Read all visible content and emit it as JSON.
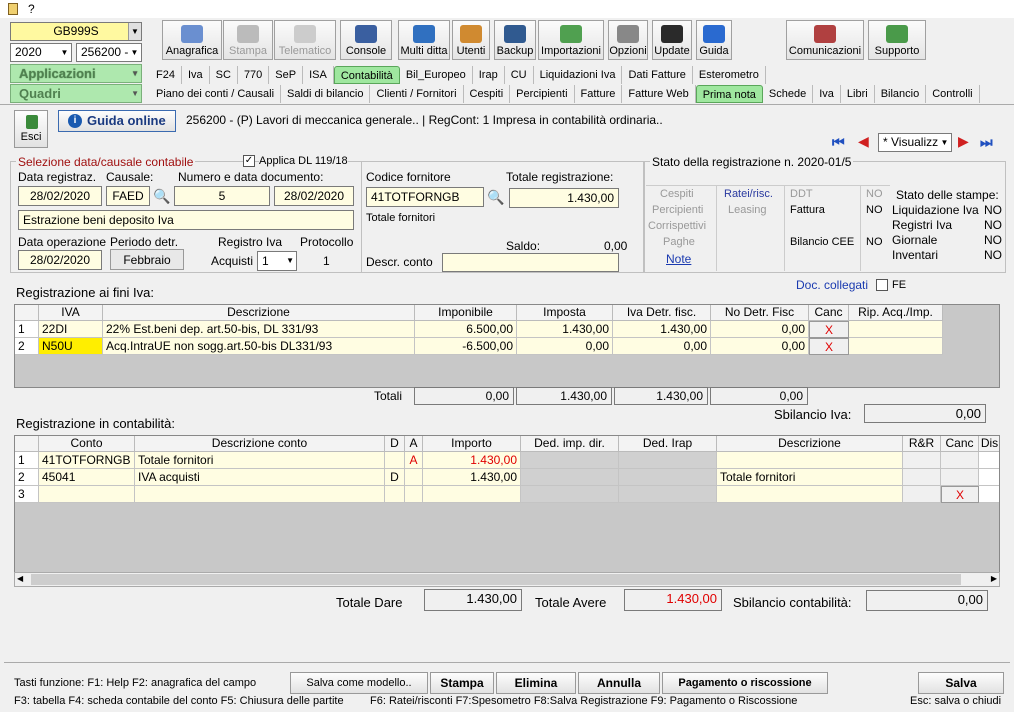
{
  "titlebar": {
    "title": "?"
  },
  "left": {
    "company": "GB999S",
    "year": "2020",
    "code": "256200 -",
    "applicazioni": "Applicazioni",
    "quadri": "Quadri"
  },
  "toolbar": [
    {
      "label": "Anagrafica",
      "color": "#6a8fd0",
      "disabled": false
    },
    {
      "label": "Stampa",
      "color": "#bbbbbb",
      "disabled": true
    },
    {
      "label": "Telematico",
      "color": "#cccccc",
      "disabled": true
    },
    {
      "label": "Console",
      "color": "#3a5fa0",
      "disabled": false
    },
    {
      "label": "Multi ditta",
      "color": "#3070c0",
      "disabled": false
    },
    {
      "label": "Utenti",
      "color": "#d08a30",
      "disabled": false
    },
    {
      "label": "Backup",
      "color": "#305a90",
      "disabled": false
    },
    {
      "label": "Importazioni",
      "color": "#50a050",
      "disabled": false
    },
    {
      "label": "Opzioni",
      "color": "#888888",
      "disabled": false
    },
    {
      "label": "Update",
      "color": "#2a2a2a",
      "disabled": false
    },
    {
      "label": "Guida",
      "color": "#2a6ad0",
      "disabled": false
    },
    {
      "label": "Comunicazioni",
      "color": "#b04040",
      "disabled": false
    },
    {
      "label": "Supporto",
      "color": "#4a9a4a",
      "disabled": false
    }
  ],
  "tabs1": [
    "F24",
    "Iva",
    "SC",
    "770",
    "SeP",
    "ISA",
    "Contabilità",
    "Bil_Europeo",
    "Irap",
    "CU",
    "Liquidazioni Iva",
    "Dati Fatture",
    "Esterometro"
  ],
  "tabs2": [
    "Piano dei conti / Causali",
    "Saldi di bilancio",
    "Clienti / Fornitori",
    "Cespiti",
    "Percipienti",
    "Fatture",
    "Fatture Web",
    "Prima nota",
    "Schede",
    "Iva",
    "Libri",
    "Bilancio",
    "Controlli"
  ],
  "header": {
    "esci": "Esci",
    "guida": "Guida online",
    "info": "256200 - (P) Lavori di meccanica generale.. | RegCont: 1 Impresa  in contabilità ordinaria..",
    "view": "* Visualizz"
  },
  "sel": {
    "title": "Selezione data/causale contabile",
    "applica": "Applica DL 119/18",
    "l_data": "Data registraz.",
    "l_causale": "Causale:",
    "l_numero": "Numero e data documento:",
    "data": "28/02/2020",
    "causale": "FAED",
    "numero": "5",
    "datadoc": "28/02/2020",
    "descr": "Estrazione beni deposito Iva",
    "l_dataop": "Data operazione",
    "l_periodo": "Periodo detr.",
    "l_registro": "Registro Iva",
    "l_protocollo": "Protocollo",
    "dataop": "28/02/2020",
    "periodo": "Febbraio",
    "l_acquisti": "Acquisti",
    "registro": "1",
    "protocollo": "1"
  },
  "forn": {
    "l_codice": "Codice fornitore",
    "codice": "41TOTFORNGB",
    "l_totale": "Totale registrazione:",
    "totale": "1.430,00",
    "descr": "Totale fornitori",
    "l_saldo": "Saldo:",
    "saldo": "0,00",
    "l_descr_conto": "Descr. conto"
  },
  "stato": {
    "title": "Stato della registrazione n. 2020-01/5",
    "cespiti": "Cespiti",
    "ratei": "Ratei/risc.",
    "ddt": "DDT",
    "ddt_v": "NO",
    "percipienti": "Percipienti",
    "leasing": "Leasing",
    "fattura": "Fattura",
    "fattura_v": "NO",
    "corrispettivi": "Corrispettivi",
    "paghe": "Paghe",
    "bilancio": "Bilancio CEE",
    "bilancio_v": "NO",
    "note": "Note",
    "stampe_title": "Stato delle stampe:",
    "stampe": [
      {
        "label": "Liquidazione Iva",
        "value": "NO"
      },
      {
        "label": "Registri Iva",
        "value": "NO"
      },
      {
        "label": "Giornale",
        "value": "NO"
      },
      {
        "label": "Inventari",
        "value": "NO"
      }
    ]
  },
  "doc": {
    "collegati": "Doc. collegati",
    "fe": "FE"
  },
  "iva": {
    "title": "Registrazione ai fini Iva:",
    "headers": [
      "IVA",
      "Descrizione",
      "Imponibile",
      "Imposta",
      "Iva Detr. fisc.",
      "No Detr. Fisc",
      "Canc",
      "Rip. Acq./Imp."
    ],
    "rows": [
      {
        "n": "1",
        "iva": "22DI",
        "descr": "22% Est.beni dep. art.50-bis, DL 331/93",
        "imponibile": "6.500,00",
        "imposta": "1.430,00",
        "detr": "1.430,00",
        "nodetr": "0,00",
        "canc": "X"
      },
      {
        "n": "2",
        "iva": "N50U",
        "descr": "Acq.IntraUE non sogg.art.50-bis DL331/93",
        "imponibile": "-6.500,00",
        "imposta": "0,00",
        "detr": "0,00",
        "nodetr": "0,00",
        "canc": "X"
      }
    ],
    "l_totali": "Totali",
    "tot_imponibile": "0,00",
    "tot_imposta": "1.430,00",
    "tot_detr": "1.430,00",
    "tot_nodetr": "0,00",
    "l_sbilancio": "Sbilancio Iva:",
    "sbilancio": "0,00"
  },
  "cont": {
    "title": "Registrazione in contabilità:",
    "headers": [
      "Conto",
      "Descrizione conto",
      "D",
      "A",
      "Importo",
      "Ded. imp. dir.",
      "Ded. Irap",
      "Descrizione",
      "R&R",
      "Canc",
      "Dis"
    ],
    "rows": [
      {
        "n": "1",
        "conto": "41TOTFORNGB",
        "descr": "Totale fornitori",
        "d": "",
        "a": "A",
        "importo": "1.430,00",
        "descr2": ""
      },
      {
        "n": "2",
        "conto": "45041",
        "descr": "IVA acquisti",
        "d": "D",
        "a": "",
        "importo": "1.430,00",
        "descr2": "Totale fornitori"
      },
      {
        "n": "3",
        "conto": "",
        "descr": "",
        "d": "",
        "a": "",
        "importo": "",
        "descr2": "",
        "canc": "X"
      }
    ],
    "l_dare": "Totale Dare",
    "dare": "1.430,00",
    "l_avere": "Totale Avere",
    "avere": "1.430,00",
    "l_sbil": "Sbilancio contabilità:",
    "sbil": "0,00"
  },
  "footer": {
    "keys1": "Tasti funzione: F1: Help  F2: anagrafica del campo",
    "keys2": "F3: tabella  F4: scheda contabile del conto  F5: Chiusura delle partite",
    "keys3": "F6: Ratei/risconti  F7:Spesometro  F8:Salva Registrazione  F9: Pagamento o Riscossione",
    "esc": "Esc: salva o chiudi",
    "salva_modello": "Salva come modello..",
    "stampa": "Stampa",
    "elimina": "Elimina",
    "annulla": "Annulla",
    "pagamento": "Pagamento o riscossione",
    "salva": "Salva"
  },
  "colors": {
    "accent": "#9fe79f",
    "input_bg": "#fffde2",
    "red": "#e00000",
    "blue": "#0000c0"
  }
}
